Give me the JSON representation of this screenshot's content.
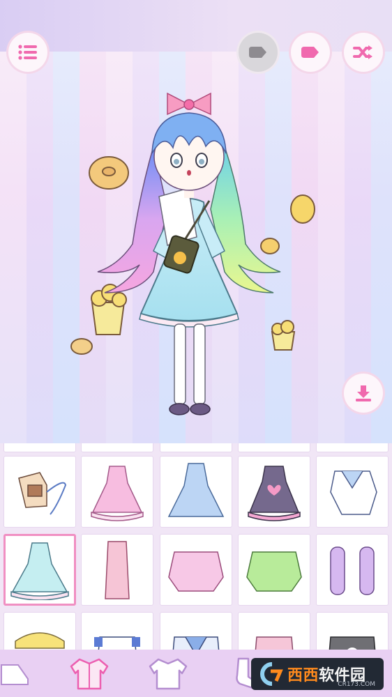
{
  "toolbar": {
    "menu_icon": "list-icon",
    "eraser_icon": "eraser-icon",
    "undo_icon": "rewind-icon",
    "shuffle_icon": "shuffle-icon",
    "save_icon": "download-icon"
  },
  "colors": {
    "accent_pink": "#f08fc2",
    "button_bg": "#fdf6fb",
    "nav_bg": "#e9d0f3"
  },
  "catalog": {
    "category": "outerwear",
    "selected_index": 5,
    "items": [
      "tan-jacket-with-purse",
      "pink-ruffle-dress",
      "blue-button-dress",
      "purple-heart-dress",
      "sailor-collar-top",
      "mint-polka-dot-dress",
      "pink-robe-coat",
      "pink-drink-sweater",
      "green-sweater",
      "lavender-puffer-sleeves",
      "yellow-hat-top",
      "blue-apron-top",
      "sailor-moon-shirt",
      "pink-overall-top",
      "gray-graphic-sweater"
    ]
  },
  "bottom_nav": {
    "tabs": [
      "shoes-tab",
      "tops-tab",
      "dress-tab",
      "socks-tab"
    ],
    "active_tab": "tops-tab"
  },
  "watermark": {
    "brand_prefix": "西西",
    "brand_suffix": "软件园",
    "url": "CR173.COM"
  }
}
